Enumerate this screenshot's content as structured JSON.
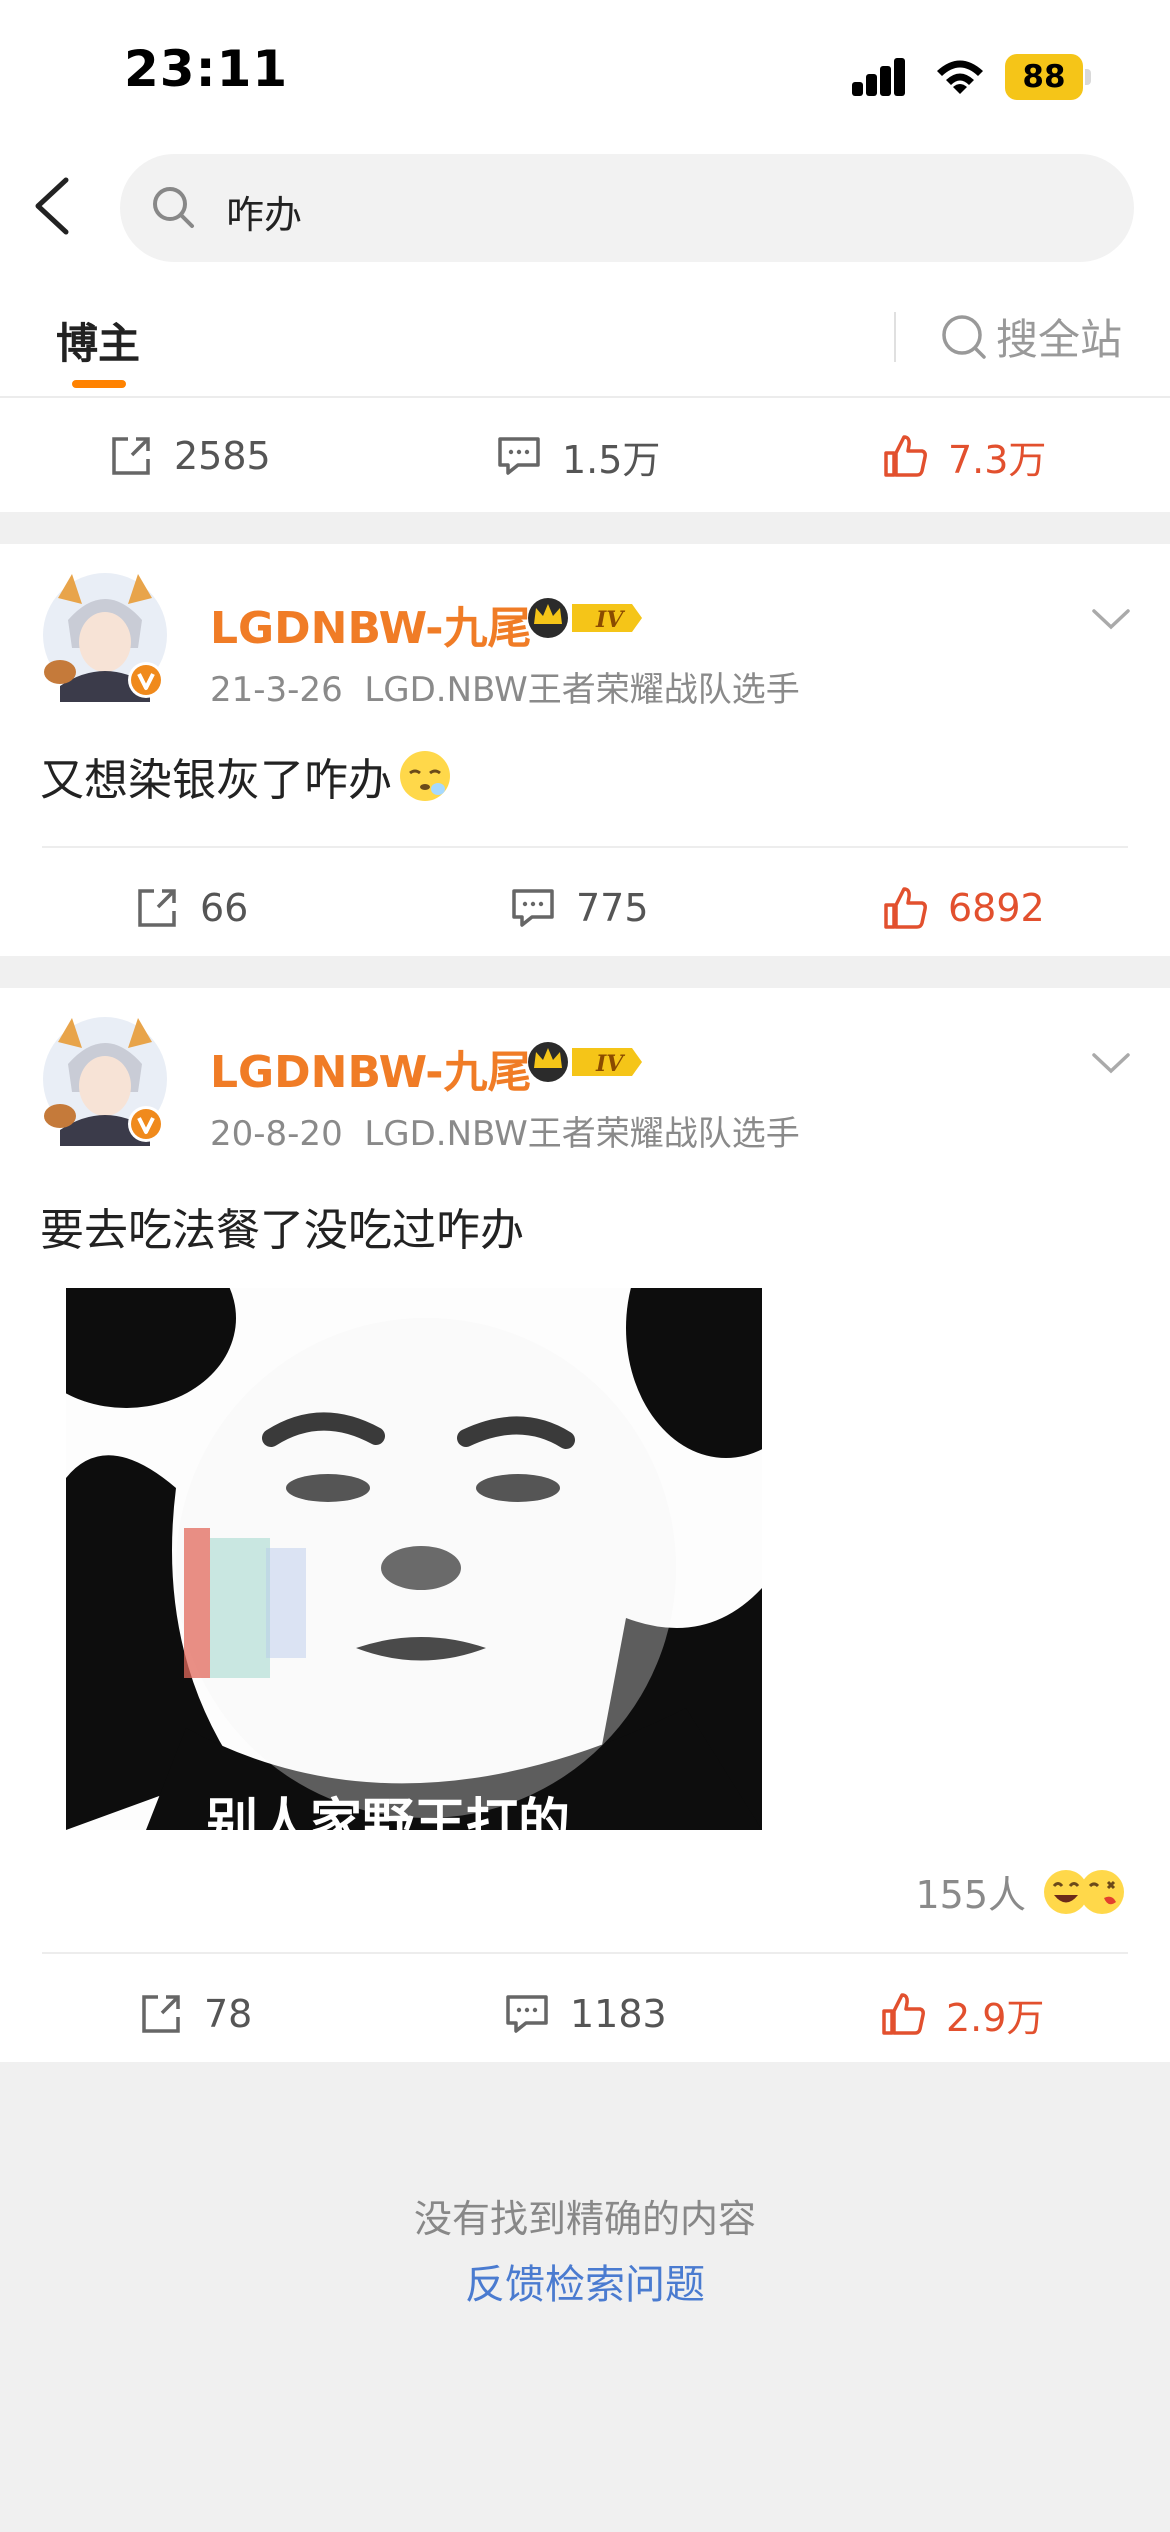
{
  "status": {
    "time": "23:11",
    "battery": "88"
  },
  "search": {
    "query": "咋办"
  },
  "tabs": {
    "active": "博主",
    "site_search": "搜全站"
  },
  "top_actions": {
    "repost": "2585",
    "comment": "1.5万",
    "like": "7.3万"
  },
  "posts": [
    {
      "user": "LGDNBW-九尾",
      "level": "IV",
      "date": "21-3-26",
      "bio": "LGD.NBW王者荣耀战队选手",
      "text": "又想染银灰了咋办",
      "actions": {
        "repost": "66",
        "comment": "775",
        "like": "6892"
      }
    },
    {
      "user": "LGDNBW-九尾",
      "level": "IV",
      "date": "20-8-20",
      "bio": "LGD.NBW王者荣耀战队选手",
      "text": "要去吃法餐了没吃过咋办",
      "image_caption": "别人家野王打的",
      "reactions": "155人",
      "actions": {
        "repost": "78",
        "comment": "1183",
        "like": "2.9万"
      }
    }
  ],
  "footer": {
    "no_result": "没有找到精确的内容",
    "feedback": "反馈检索问题"
  },
  "colors": {
    "accent": "#ff8200",
    "username": "#f07c26",
    "like": "#e2502e",
    "link": "#4a7bd0"
  }
}
